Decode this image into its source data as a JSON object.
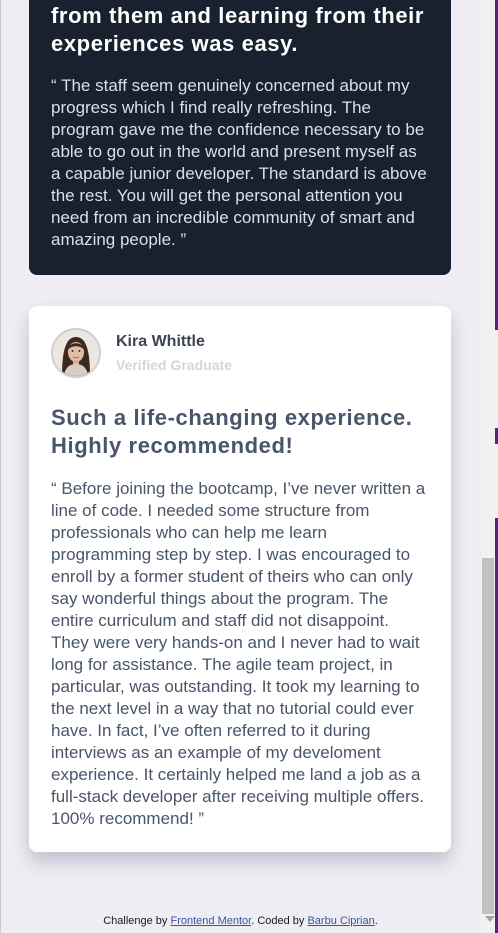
{
  "testimonials": [
    {
      "headline": "from them and learning from their experiences was easy.",
      "quote": "“ The staff seem genuinely concerned about my progress which I find really refreshing. The program gave me the confidence necessary to be able to go out in the world and present myself as a capable junior developer. The standard is above the rest. You will get the personal attention you need from an incredible community of smart and amazing people. ”"
    },
    {
      "name": "Kira Whittle",
      "status": "Verified Graduate",
      "headline": "Such a life-changing experience. Highly recommended!",
      "quote": "“ Before joining the bootcamp, I’ve never written a line of code. I needed some structure from professionals who can help me learn programming step by step. I was encouraged to enroll by a former student of theirs who can only say wonderful things about the program. The entire curriculum and staff did not disappoint. They were very hands-on and I never had to wait long for assistance. The agile team project, in particular, was outstanding. It took my learning to the next level in a way that no tutorial could ever have. In fact, I’ve often referred to it during interviews as an example of my develoment experience. It certainly helped me land a job as a full-stack developer after receiving multiple offers. 100% recommend! ”"
    }
  ],
  "footer": {
    "prefix": "Challenge by",
    "link1": "Frontend Mentor",
    "middle": ". Coded by",
    "link2": "Barbu Ciprian",
    "suffix": "."
  },
  "colors": {
    "page_bg": "#efedf4",
    "dark_card": "#19212e",
    "light_card": "#ffffff",
    "text_slate": "#48556a"
  }
}
